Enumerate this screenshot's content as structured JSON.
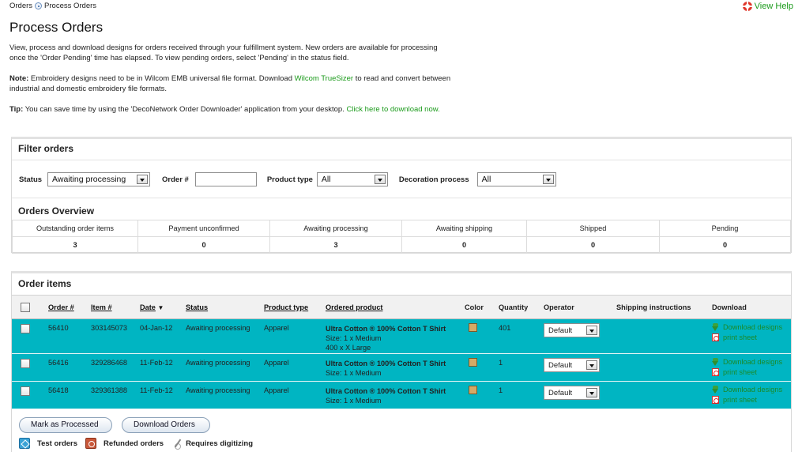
{
  "breadcrumb": {
    "item1": "Orders",
    "item2": "Process Orders"
  },
  "help": {
    "label": "View Help"
  },
  "page_title": "Process Orders",
  "intro": {
    "p1": "View, process and download designs for orders received through your fulfillment system. New orders are available for processing once the 'Order Pending' time has elapsed. To view pending orders, select 'Pending' in the status field.",
    "note_label": "Note:",
    "note_text": " Embroidery designs need to be in Wilcom EMB universal file format. Download ",
    "note_link": "Wilcom TrueSizer",
    "note_text2": " to read and convert between industrial and domestic embroidery file formats.",
    "tip_label": "Tip:",
    "tip_text": " You can save time by using the 'DecoNetwork Order Downloader' application from your desktop. ",
    "tip_link": "Click here to download now."
  },
  "filter": {
    "title": "Filter orders",
    "status_label": "Status",
    "status_value": "Awaiting processing",
    "order_label": "Order #",
    "order_value": "",
    "product_type_label": "Product type",
    "product_type_value": "All",
    "decoration_label": "Decoration process",
    "decoration_value": "All"
  },
  "overview": {
    "title": "Orders Overview",
    "columns": [
      "Outstanding order items",
      "Payment unconfirmed",
      "Awaiting processing",
      "Awaiting shipping",
      "Shipped",
      "Pending"
    ],
    "values": [
      "3",
      "0",
      "3",
      "0",
      "0",
      "0"
    ]
  },
  "items": {
    "title": "Order items",
    "headers": {
      "order": "Order #",
      "item": "Item #",
      "date": "Date",
      "status": "Status",
      "product_type": "Product type",
      "ordered_product": "Ordered product",
      "color": "Color",
      "quantity": "Quantity",
      "operator": "Operator",
      "shipping": "Shipping instructions",
      "download": "Download"
    },
    "rows": [
      {
        "order": "56410",
        "item": "303145073",
        "date": "04-Jan-12",
        "status": "Awaiting processing",
        "product_type": "Apparel",
        "product": "Ultra Cotton ® 100% Cotton T Shirt",
        "size": "Size: 1 x Medium",
        "extra": "400 x X Large",
        "color": "#d4aa66",
        "quantity": "401",
        "operator": "Default",
        "shipping": "",
        "download_designs": "Download designs",
        "print_sheet": "print sheet"
      },
      {
        "order": "56416",
        "item": "329286468",
        "date": "11-Feb-12",
        "status": "Awaiting processing",
        "product_type": "Apparel",
        "product": "Ultra Cotton ® 100% Cotton T Shirt",
        "size": "Size: 1 x Medium",
        "extra": "",
        "color": "#d4aa66",
        "quantity": "1",
        "operator": "Default",
        "shipping": "",
        "download_designs": "Download designs",
        "print_sheet": "print sheet"
      },
      {
        "order": "56418",
        "item": "329361388",
        "date": "11-Feb-12",
        "status": "Awaiting processing",
        "product_type": "Apparel",
        "product": "Ultra Cotton ® 100% Cotton T Shirt",
        "size": "Size: 1 x Medium",
        "extra": "",
        "color": "#d4aa66",
        "quantity": "1",
        "operator": "Default",
        "shipping": "",
        "download_designs": "Download designs",
        "print_sheet": "print sheet"
      }
    ]
  },
  "actions": {
    "mark_processed": "Mark as Processed",
    "download_orders": "Download Orders"
  },
  "legend": {
    "test": "Test orders",
    "refunded": "Refunded orders",
    "digitizing": "Requires digitizing"
  },
  "colors": {
    "row_highlight": "#00b5c2",
    "link": "#1a9a1a",
    "help_icon": "#e0362a"
  }
}
